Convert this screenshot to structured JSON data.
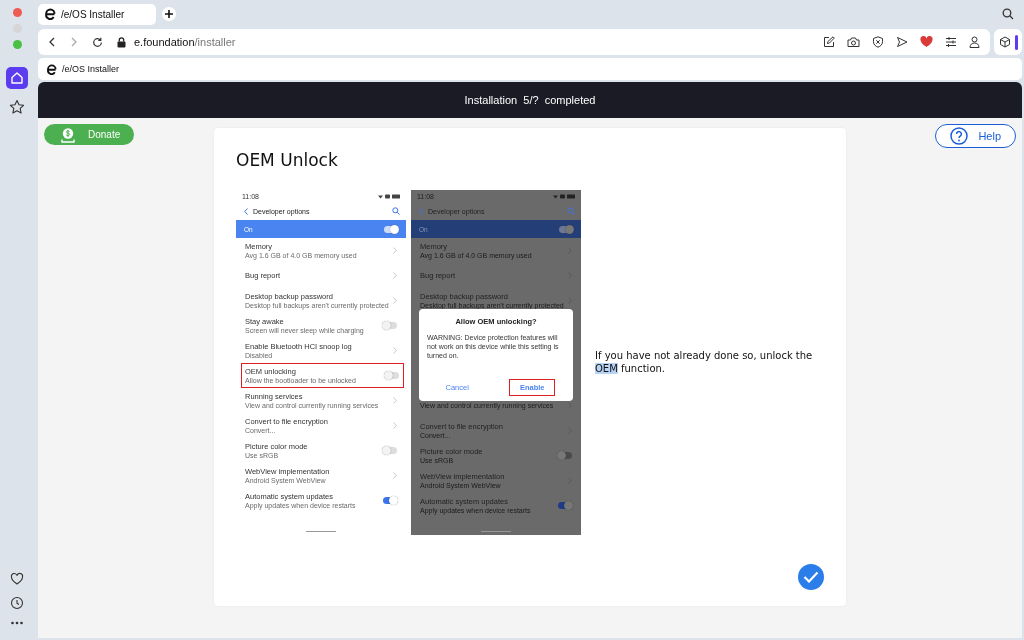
{
  "browser": {
    "tab": {
      "title": "/e/OS Installer",
      "selected": true
    },
    "url": {
      "host": "e.foundation",
      "path": "/installer"
    },
    "bookmark": "/e/OS Installer"
  },
  "progress": "Installation  5/?  completed",
  "donate": "Donate",
  "help": "Help",
  "card": {
    "title": "OEM Unlock",
    "phones": [
      {
        "time": "11:08",
        "header": "Developer options",
        "master": {
          "label": "On",
          "on": true
        },
        "dimmed": false,
        "items_before": [
          {
            "title": "Memory",
            "subtitle": "Avg 1.6 GB of 4.0 GB memory used",
            "kind": "chevron",
            "highlighted": false
          },
          {
            "title": "Bug report",
            "kind": "chevron",
            "highlighted": false
          },
          {
            "title": "Desktop backup password",
            "subtitle": "Desktop full backups aren't currently protected",
            "kind": "chevron",
            "highlighted": false
          },
          {
            "title": "Stay awake",
            "subtitle": "Screen will never sleep while charging",
            "kind": "toggle",
            "on": false,
            "highlighted": false
          },
          {
            "title": "Enable Bluetooth HCI snoop log",
            "subtitle": "Disabled",
            "kind": "chevron",
            "highlighted": false
          },
          {
            "title": "OEM unlocking",
            "subtitle": "Allow the bootloader to be unlocked",
            "kind": "toggle",
            "on": false,
            "highlighted": true
          },
          {
            "title": "Running services",
            "subtitle": "View and control currently running services",
            "kind": "chevron",
            "highlighted": false
          },
          {
            "title": "Convert to file encryption",
            "subtitle": "Convert...",
            "kind": "chevron",
            "highlighted": false
          },
          {
            "title": "Picture color mode",
            "subtitle": "Use sRGB",
            "kind": "toggle",
            "on": false,
            "highlighted": false
          },
          {
            "title": "WebView implementation",
            "subtitle": "Android System WebView",
            "kind": "chevron",
            "highlighted": false
          },
          {
            "title": "Automatic system updates",
            "subtitle": "Apply updates when device restarts",
            "kind": "toggle",
            "on": true,
            "highlighted": false
          }
        ]
      },
      {
        "time": "11:08",
        "header": "Developer options",
        "master": {
          "label": "On",
          "on": true
        },
        "dimmed": true,
        "items_before": [
          {
            "title": "Memory",
            "subtitle": "Avg 1.6 GB of 4.0 GB memory used",
            "kind": "chevron",
            "highlighted": false
          },
          {
            "title": "Bug report",
            "kind": "chevron",
            "highlighted": false
          },
          {
            "title": "Desktop backup password",
            "subtitle": "Desktop full backups aren't currently protected",
            "kind": "chevron",
            "highlighted": false
          }
        ],
        "dialog": {
          "title": "Allow OEM unlocking?",
          "message": "WARNING: Device protection features will not work on this device while this setting is turned on.",
          "buttons": [
            {
              "label": "Cancel",
              "highlighted": false
            },
            {
              "label": "Enable",
              "highlighted": true
            }
          ]
        },
        "items_after": [
          {
            "subtitle": "View and control currently running services",
            "kind": "chevron",
            "highlighted": false
          },
          {
            "title": "Convert to file encryption",
            "subtitle": "Convert...",
            "kind": "chevron",
            "highlighted": false
          },
          {
            "title": "Picture color mode",
            "subtitle": "Use sRGB",
            "kind": "toggle",
            "on": false,
            "highlighted": false
          },
          {
            "title": "WebView implementation",
            "subtitle": "Android System WebView",
            "kind": "chevron",
            "highlighted": false
          },
          {
            "title": "Automatic system updates",
            "subtitle": "Apply updates when device restarts",
            "kind": "toggle",
            "on": true,
            "highlighted": false
          }
        ]
      }
    ],
    "instruction": [
      {
        "text": "If you have not already done so, unlock the ",
        "selected": false
      },
      {
        "text": "OEM",
        "selected": true
      },
      {
        "text": " function.",
        "selected": false
      }
    ]
  }
}
